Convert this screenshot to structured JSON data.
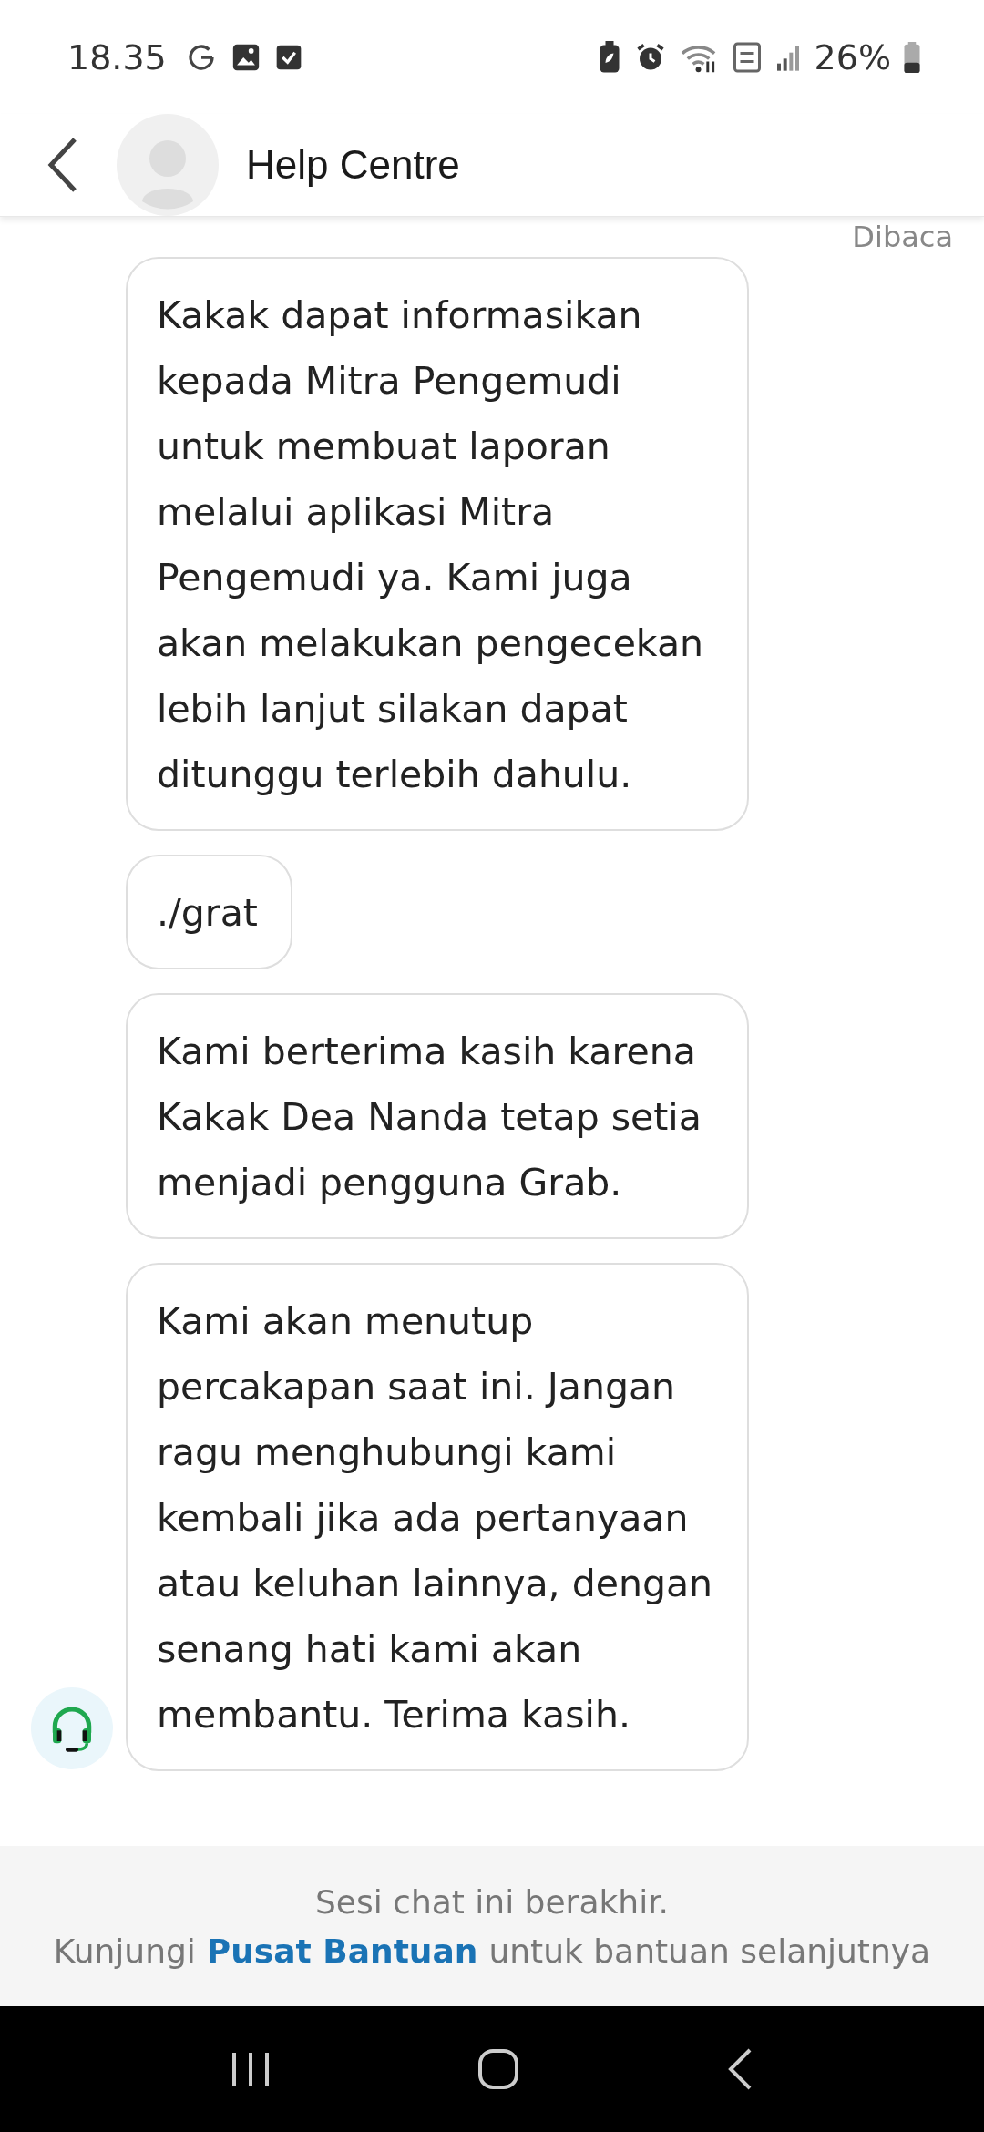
{
  "status_bar": {
    "time": "18.35",
    "battery": "26%"
  },
  "header": {
    "title": "Help Centre"
  },
  "read_receipt": "Dibaca",
  "messages": [
    {
      "text": "Kakak dapat informasikan kepada Mitra Pengemudi untuk membuat laporan melalui aplikasi Mitra Pengemudi ya. Kami juga akan melakukan pengecekan lebih lanjut silakan dapat ditunggu terlebih dahulu."
    },
    {
      "text": "./grat"
    },
    {
      "text": "Kami berterima kasih karena Kakak Dea Nanda tetap setia menjadi pengguna Grab."
    },
    {
      "text": "Kami akan menutup percakapan saat ini. Jangan ragu menghubungi kami kembali jika ada pertanyaan atau keluhan lainnya, dengan senang hati kami akan membantu. Terima kasih."
    }
  ],
  "footer": {
    "notice": "Sesi chat ini berakhir.",
    "prefix": "Kunjungi",
    "link": "Pusat Bantuan",
    "suffix": "untuk bantuan selanjutnya"
  }
}
